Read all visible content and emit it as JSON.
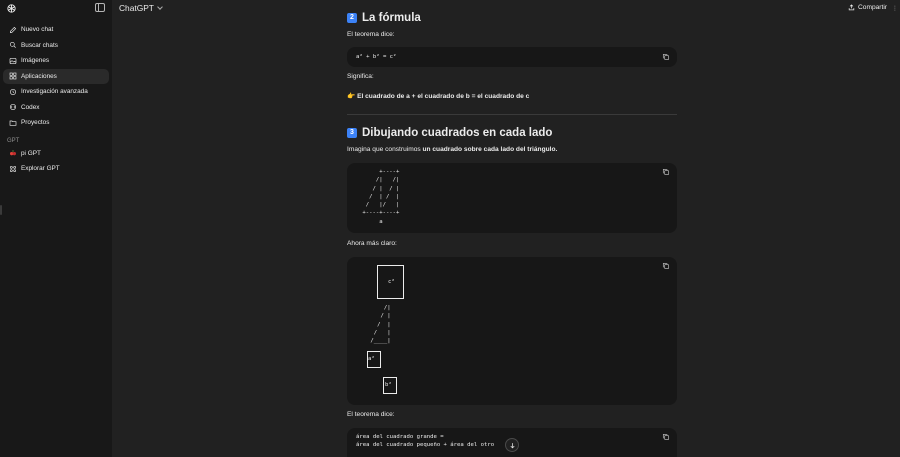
{
  "sidebar": {
    "items": [
      {
        "label": "Nuevo chat",
        "icon": "edit-icon"
      },
      {
        "label": "Buscar chats",
        "icon": "search-icon"
      },
      {
        "label": "Imágenes",
        "icon": "image-icon"
      },
      {
        "label": "Aplicaciones",
        "icon": "apps-icon"
      },
      {
        "label": "Investigación avanzada",
        "icon": "research-icon"
      },
      {
        "label": "Codex",
        "icon": "code-icon"
      },
      {
        "label": "Proyectos",
        "icon": "folder-icon"
      }
    ],
    "section_label": "GPT",
    "gpt_items": [
      {
        "label": "pi GPT",
        "icon": "gpt-avatar-icon"
      },
      {
        "label": "Explorar GPT",
        "icon": "explore-icon"
      }
    ]
  },
  "header": {
    "model": "ChatGPT",
    "share_label": "Compartir"
  },
  "content": {
    "section2_num": "2",
    "section2_title": "La fórmula",
    "theorem_says_1": "El teorema dice:",
    "formula": "a² + b² = c²",
    "meaning_label": "Significa:",
    "meaning_emoji": "👉",
    "meaning_text": "El cuadrado de a + el cuadrado de b = el cuadrado de c",
    "section3_num": "3",
    "section3_title": "Dibujando cuadrados en cada lado",
    "imagine_prefix": "Imagina que construimos ",
    "imagine_bold": "un cuadrado sobre cada lado del triángulo.",
    "ascii_triangle": "      +----+\n     /|   /|\n    / |  / |\n   /  | /  |\n  /   |/   |\n +----+----+\n      a",
    "clearer_label": "Ahora más claro:",
    "c2_label": "c²",
    "ascii_triangle2": "     /|\n    / |\n   /  |\n  /   |\n /____|",
    "a2_label": "a²",
    "b2_label": "b²",
    "theorem_says_2": "El teorema dice:",
    "area_line1": "área del cuadrado grande =",
    "area_line2": "área del cuadrado pequeño + área del otro"
  }
}
